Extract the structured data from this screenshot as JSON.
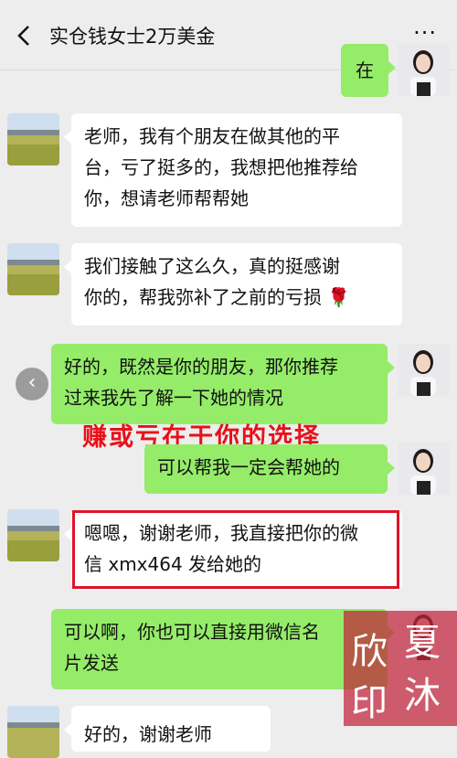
{
  "header": {
    "back_icon": "chevron-left-icon",
    "title": "实仓钱女士2万美金",
    "more_icon": "more-dots-icon",
    "more_label": "···"
  },
  "messages": [
    {
      "side": "right",
      "text": "在"
    },
    {
      "side": "left",
      "lines": [
        "老师，我有个朋友在做其他的平",
        "台，亏了挺多的，我想把他推荐给",
        "你，想请老师帮帮她"
      ]
    },
    {
      "side": "left",
      "lines": [
        "我们接触了这么久，真的挺感谢",
        "你的，帮我弥补了之前的亏损"
      ],
      "emoji": "🌹"
    },
    {
      "side": "right",
      "lines": [
        "好的，既然是你的朋友，那你推荐",
        "过来我先了解一下她的情况"
      ]
    },
    {
      "side": "right",
      "text": "可以帮我一定会帮她的"
    },
    {
      "side": "left",
      "lines": [
        "嗯嗯，谢谢老师，我直接把你的微",
        "信 xmx464 发给她的"
      ]
    },
    {
      "side": "right",
      "lines": [
        "可以啊，你也可以直接用微信名",
        "片发送"
      ]
    },
    {
      "side": "left",
      "text": "好的，谢谢老师"
    }
  ],
  "overlay_text": "赚或亏在于你的选择",
  "scroll_button_icon": "chevron-left-icon",
  "watermark": {
    "chars": [
      "欣",
      "夏",
      "印",
      "沐"
    ],
    "color": "#c0223a"
  },
  "colors": {
    "right_bubble": "#95ec69",
    "left_bubble": "#ffffff",
    "background": "#ededed",
    "highlight_box": "#e2122a"
  }
}
